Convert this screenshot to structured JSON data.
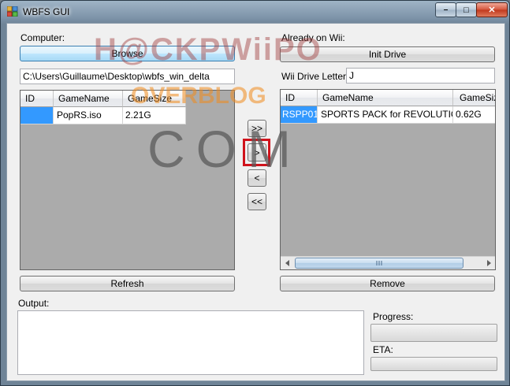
{
  "window": {
    "title": "WBFS GUI",
    "controls": {
      "minimize": "–",
      "maximize": "□",
      "close": "✕"
    }
  },
  "left": {
    "label": "Computer:",
    "browse_label": "Browse",
    "path_value": "C:\\Users\\Guillaume\\Desktop\\wbfs_win_delta",
    "columns": [
      "ID",
      "GameName",
      "GameSize"
    ],
    "rows": [
      {
        "id": "",
        "name": "PopRS.iso",
        "size": "2.21G"
      }
    ],
    "refresh_label": "Refresh"
  },
  "transfer": {
    "all_right": ">>",
    "one_right": ">",
    "one_left": "<",
    "all_left": "<<"
  },
  "right": {
    "label": "Already on Wii:",
    "init_label": "Init Drive",
    "drive_label": "Wii Drive Letter",
    "drive_value": "J",
    "columns": [
      "ID",
      "GameName",
      "GameSize"
    ],
    "rows": [
      {
        "id": "RSPP01",
        "name": "SPORTS PACK for REVOLUTION",
        "size": "0.62G"
      }
    ],
    "remove_label": "Remove"
  },
  "output": {
    "label": "Output:",
    "value": ""
  },
  "progress": {
    "label": "Progress:",
    "value": 0,
    "eta_label": "ETA:",
    "eta_value": ""
  },
  "watermark": {
    "line1": "H@CKPWiiPO",
    "line2": "OVERBLOG",
    "line3": "COM"
  },
  "colors": {
    "selection": "#3399ff",
    "highlight_frame": "#d0121b",
    "watermark_red": "#e0281e",
    "watermark_orange": "#f08a1c",
    "watermark_grey": "#707070"
  }
}
